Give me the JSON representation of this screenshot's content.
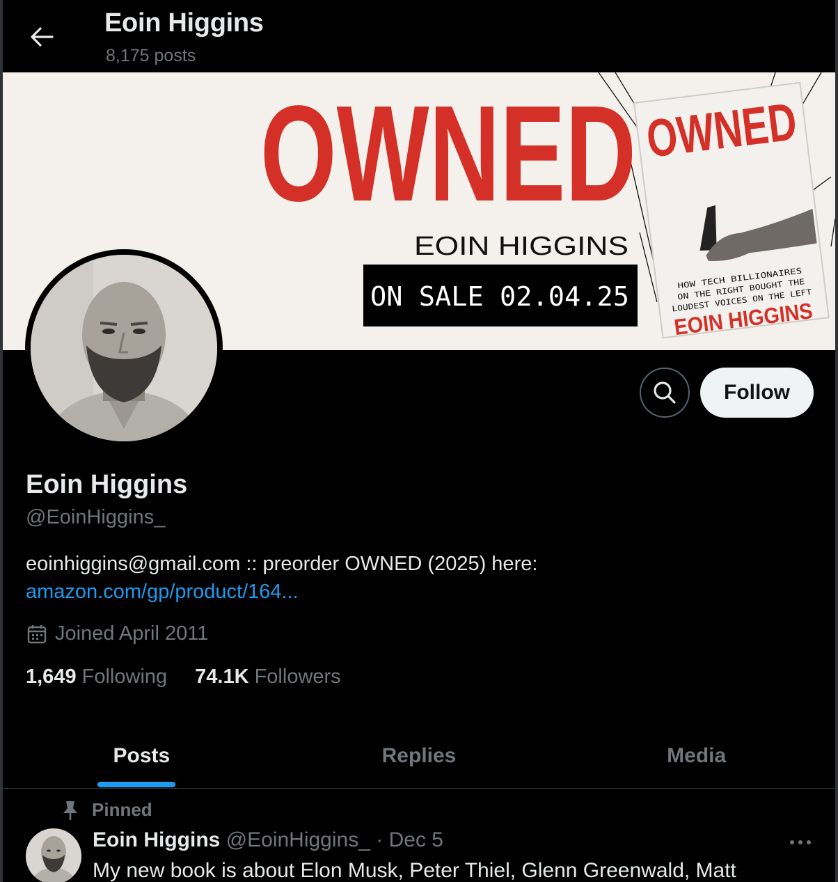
{
  "header": {
    "title": "Eoin Higgins",
    "post_count": "8,175 posts"
  },
  "banner": {
    "headline": "OWNED",
    "author": "EOIN HIGGINS",
    "sale": "ON SALE 02.04.25",
    "book_title": "OWNED",
    "book_subtitle_1": "HOW TECH BILLIONAIRES",
    "book_subtitle_2": "ON THE RIGHT BOUGHT THE",
    "book_subtitle_3": "LOUDEST VOICES ON THE LEFT",
    "book_author": "EOIN HIGGINS",
    "colors": {
      "red": "#d43027",
      "cream": "#f4f1ec"
    }
  },
  "profile": {
    "name": "Eoin Higgins",
    "handle": "@EoinHiggins_",
    "bio_text": "eoinhiggins@gmail.com :: preorder OWNED (2025) here:",
    "bio_link": "amazon.com/gp/product/164...",
    "joined": "Joined April 2011",
    "following_count": "1,649",
    "following_label": "Following",
    "followers_count": "74.1K",
    "followers_label": "Followers"
  },
  "actions": {
    "follow_label": "Follow",
    "search_icon": "search-icon"
  },
  "tabs": [
    {
      "label": "Posts",
      "active": true
    },
    {
      "label": "Replies",
      "active": false
    },
    {
      "label": "Media",
      "active": false
    }
  ],
  "pinned_post": {
    "pinned_label": "Pinned",
    "author": "Eoin Higgins",
    "handle": "@EoinHiggins_",
    "separator": "·",
    "date": "Dec 5",
    "text": "My new book is about Elon Musk, Peter Thiel, Glenn Greenwald, Matt"
  },
  "theme": {
    "accent": "#1d9bf0",
    "background": "#000000",
    "muted": "#71767b",
    "text": "#e7e9ea"
  }
}
